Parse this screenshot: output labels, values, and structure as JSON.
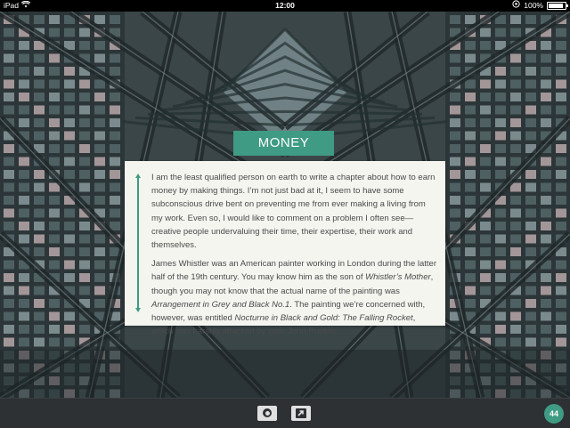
{
  "status_bar": {
    "device": "iPad",
    "time": "12:00",
    "battery": "100%",
    "battery_level": 1.0
  },
  "chapter": {
    "title": "MONEY",
    "paragraphs": [
      [
        {
          "text": "I am the least qualified person on earth to write a chapter about how to earn money by making things. I’m not just bad at it, I seem to have some subconscious drive bent on preventing me from ever making a living from my work. Even so, I would like to comment on a problem I often see—creative people undervaluing their time, their expertise, their work and themselves.",
          "italic": false
        }
      ],
      [
        {
          "text": "James Whistler was an American painter working in London during the latter half of the 19th century. You may know him as the son of ",
          "italic": false
        },
        {
          "text": "Whistler’s Mother",
          "italic": true
        },
        {
          "text": ", though you may not know that the actual name of the painting was ",
          "italic": false
        },
        {
          "text": "Arrangement in Grey and Black No.1",
          "italic": true
        },
        {
          "text": ". The painting we’re concerned with, however, was entitled ",
          "italic": false
        },
        {
          "text": "Nocturne in Black and Gold: The Falling Rocket",
          "italic": true
        },
        {
          "text": ", which was harshly attacked by critic John Ruskin.",
          "italic": false
        }
      ]
    ]
  },
  "toolbar": {
    "camera_icon": "camera-icon",
    "share_icon": "share-arrow-icon",
    "page_number": "44"
  },
  "colors": {
    "accent": "#3f9b83",
    "card": "#f5f5f0",
    "toolbar": "#2e3134"
  }
}
